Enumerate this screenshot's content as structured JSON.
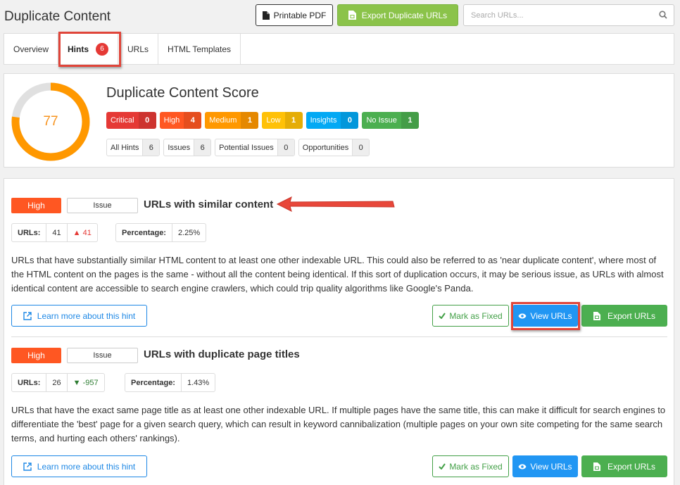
{
  "header": {
    "title": "Duplicate Content",
    "pdf_label": "Printable PDF",
    "export_dup_label": "Export Duplicate URLs",
    "search_placeholder": "Search URLs..."
  },
  "tabs": [
    {
      "label": "Overview"
    },
    {
      "label": "Hints",
      "badge": "6",
      "active": true
    },
    {
      "label": "URLs"
    },
    {
      "label": "HTML Templates"
    }
  ],
  "score": {
    "title": "Duplicate Content Score",
    "value": "77",
    "fraction": 0.77,
    "severities": [
      {
        "label": "Critical",
        "count": "0",
        "color": "#e53935"
      },
      {
        "label": "High",
        "count": "4",
        "color": "#ff5722"
      },
      {
        "label": "Medium",
        "count": "1",
        "color": "#ff9800"
      },
      {
        "label": "Low",
        "count": "1",
        "color": "#ffc107"
      },
      {
        "label": "Insights",
        "count": "0",
        "color": "#03a9f4"
      },
      {
        "label": "No Issue",
        "count": "1",
        "color": "#4caf50"
      }
    ],
    "categories": [
      {
        "label": "All Hints",
        "count": "6"
      },
      {
        "label": "Issues",
        "count": "6"
      },
      {
        "label": "Potential Issues",
        "count": "0"
      },
      {
        "label": "Opportunities",
        "count": "0"
      }
    ]
  },
  "hints": [
    {
      "priority": "High",
      "type": "Issue",
      "title": "URLs with similar content",
      "urls_label": "URLs:",
      "urls": "41",
      "change": "41",
      "change_dir": "up",
      "pct_label": "Percentage:",
      "pct": "2.25%",
      "description": "URLs that have substantially similar HTML content to at least one other indexable URL. This could also be referred to as 'near duplicate content', where most of the HTML content on the pages is the same - without all the content being identical. If this sort of duplication occurs, it may be serious issue, as URLs with almost identical content are accessible to search engine crawlers, which could trip quality algorithms like Google's Panda.",
      "learn_label": "Learn more about this hint",
      "fixed_label": "Mark as Fixed",
      "view_label": "View URLs",
      "export_label": "Export URLs"
    },
    {
      "priority": "High",
      "type": "Issue",
      "title": "URLs with duplicate page titles",
      "urls_label": "URLs:",
      "urls": "26",
      "change": "-957",
      "change_dir": "down",
      "pct_label": "Percentage:",
      "pct": "1.43%",
      "description": "URLs that have the exact same page title as at least one other indexable URL. If multiple pages have the same title, this can make it difficult for search engines to differentiate the 'best' page for a given search query, which can result in keyword cannibalization (multiple pages on your own site competing for the same search terms, and hurting each others' rankings).",
      "learn_label": "Learn more about this hint",
      "fixed_label": "Mark as Fixed",
      "view_label": "View URLs",
      "export_label": "Export URLs"
    }
  ]
}
